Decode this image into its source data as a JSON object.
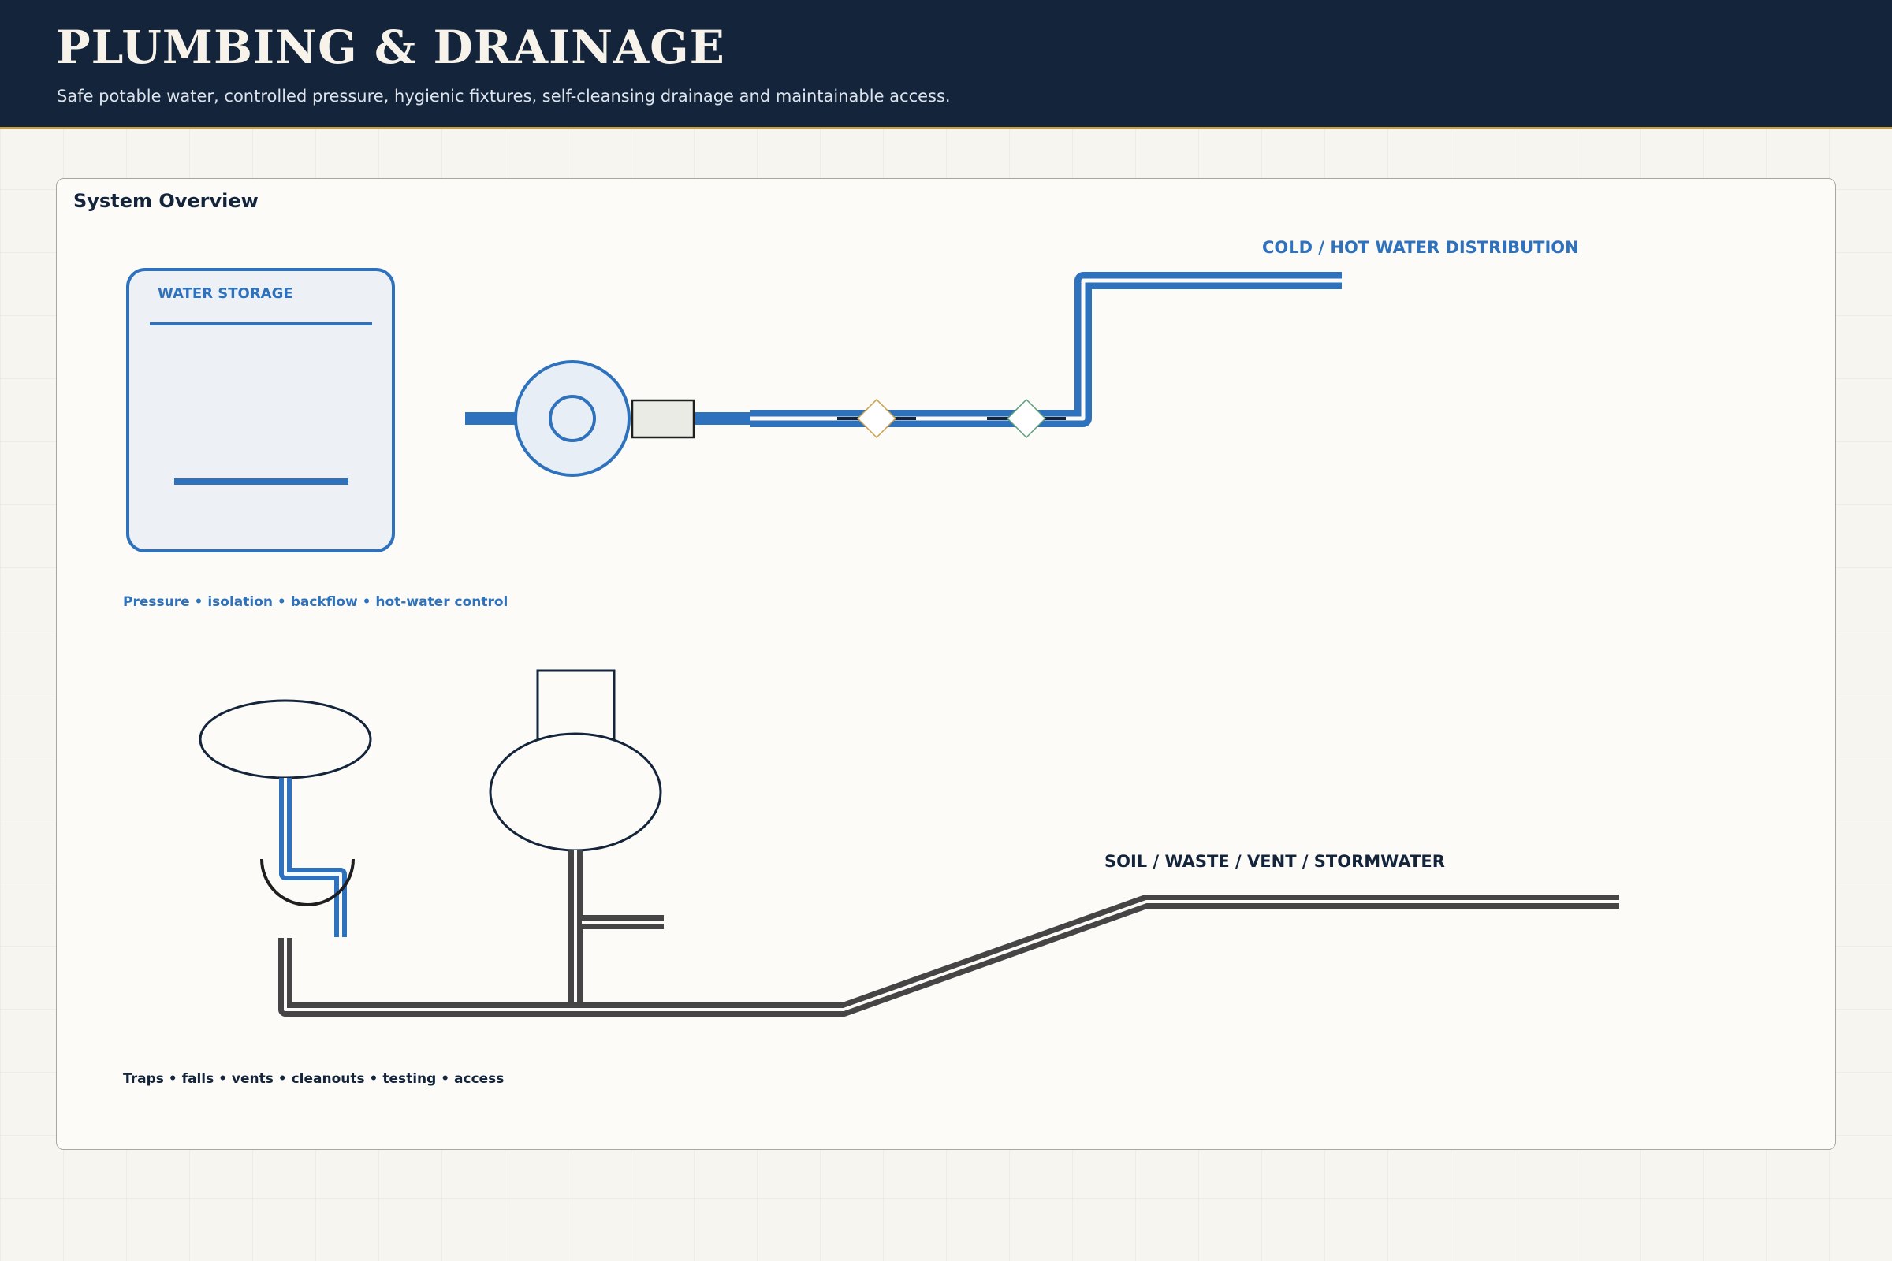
{
  "header": {
    "title": "PLUMBING & DRAINAGE",
    "subtitle": "Safe potable water, controlled pressure, hygienic fixtures, self-cleansing drainage and maintainable access."
  },
  "panel": {
    "title": "System Overview"
  },
  "supply": {
    "tank_label": "WATER STORAGE",
    "distribution_label": "COLD / HOT WATER DISTRIBUTION",
    "caption": "Pressure • isolation • backflow • hot-water control"
  },
  "drainage": {
    "main_label": "SOIL / WASTE / VENT / STORMWATER",
    "caption": "Traps • falls • vents • cleanouts • testing • access"
  },
  "colors": {
    "navy": "#13243b",
    "accent_gold": "#c9a04a",
    "supply_blue": "#2e72bd",
    "drain_grey": "#454545",
    "valve_outline_gold": "#c9a04a",
    "valve_outline_green": "#5a9e7a"
  }
}
